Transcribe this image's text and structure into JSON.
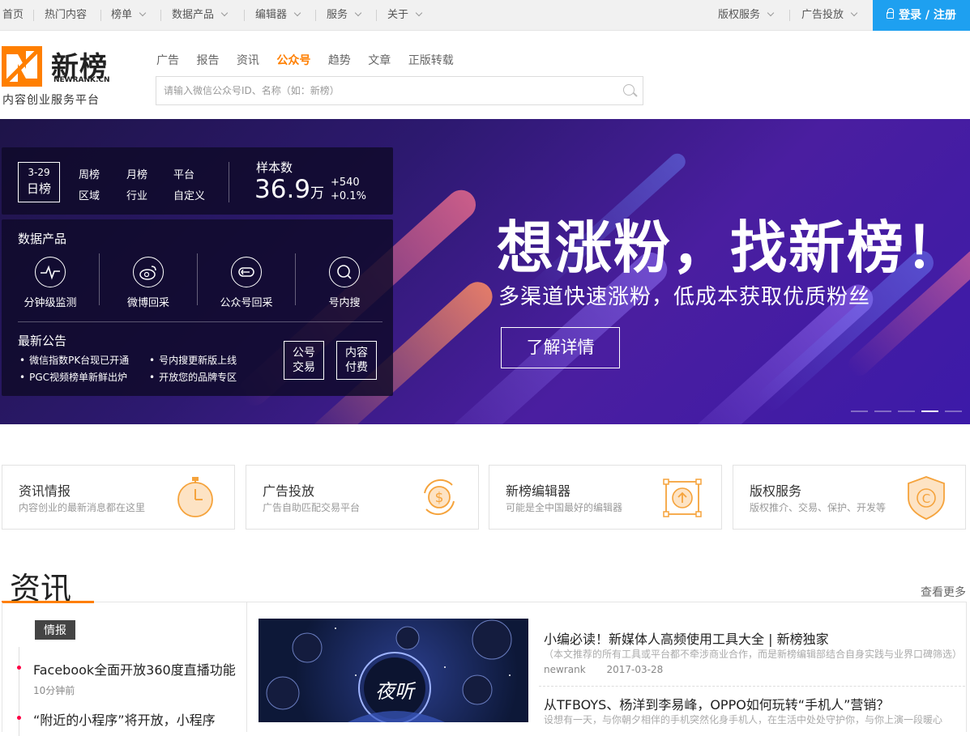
{
  "topbar": {
    "left_items": [
      "首页",
      "热门内容",
      "榜单",
      "数据产品",
      "编辑器",
      "服务",
      "关于"
    ],
    "right_items": [
      "版权服务",
      "广告投放"
    ],
    "login_label": "登录 / 注册"
  },
  "header": {
    "logo_name": "新榜",
    "logo_en": "NEWRANK.CN",
    "tagline": "内容创业服务平台",
    "nav": [
      "广告",
      "报告",
      "资讯",
      "公众号",
      "趋势",
      "文章",
      "正版转载"
    ],
    "active_nav": "公众号",
    "search_placeholder": "请输入微信公众号ID、名称（如：新榜）"
  },
  "banner": {
    "date": "3-29",
    "date_label": "日榜",
    "rank_links": [
      "周榜",
      "月榜",
      "平台",
      "区域",
      "行业",
      "自定义"
    ],
    "sample_title": "样本数",
    "sample_value": "36.9",
    "sample_unit": "万",
    "delta_abs": "+540",
    "delta_pct": "+0.1%",
    "products_title": "数据产品",
    "products": [
      "分钟级监测",
      "微博回采",
      "公众号回采",
      "号内搜"
    ],
    "announce_title": "最新公告",
    "announcements": [
      "微信指数PK台现已开通",
      "号内搜更新版上线",
      "PGC视频榜单新鲜出炉",
      "开放您的品牌专区"
    ],
    "side_buttons": [
      [
        "公号",
        "交易"
      ],
      [
        "内容",
        "付费"
      ]
    ],
    "slogan": "想涨粉，找新榜！",
    "slogan_sub": "多渠道快速涨粉，低成本获取优质粉丝",
    "cta": "了解详情",
    "slide_count": 5,
    "active_slide": 4
  },
  "cards": [
    {
      "title": "资讯情报",
      "desc": "内容创业的最新消息都在这里",
      "icon": "stopwatch-icon"
    },
    {
      "title": "广告投放",
      "desc": "广告自助匹配交易平台",
      "icon": "dollar-coin-icon"
    },
    {
      "title": "新榜编辑器",
      "desc": "可能是全中国最好的编辑器",
      "icon": "upload-arrow-icon"
    },
    {
      "title": "版权服务",
      "desc": "版权推介、交易、保护、开发等",
      "icon": "copyright-shield-icon"
    }
  ],
  "news": {
    "section_title": "资讯",
    "see_more": "查看更多",
    "tag": "情报",
    "timeline": [
      {
        "title": "Facebook全面开放360度直播功能",
        "time": "10分钟前"
      },
      {
        "title": "“附近的小程序”将开放，小程序",
        "time": ""
      }
    ],
    "articles": [
      {
        "title": "小编必读！新媒体人高频使用工具大全 | 新榜独家",
        "desc": "（本文推荐的所有工具或平台都不牵涉商业合作，而是新榜编辑部结合自身实践与业界口碑筛选）",
        "author": "newrank",
        "date": "2017-03-28"
      },
      {
        "title": "从TFBOYS、杨洋到李易峰，OPPO如何玩转“手机人”营销？",
        "desc": "设想有一天，与你朝夕相伴的手机突然化身手机人，在生活中处处守护你，与你上演一段暖心",
        "author": "",
        "date": ""
      }
    ],
    "thumb_labels": [
      "夜听"
    ]
  },
  "colors": {
    "brand": "#ff7f00",
    "login": "#1ea0f0",
    "banner_dark": "#1e1448",
    "banner_light": "#4a1ea0"
  }
}
